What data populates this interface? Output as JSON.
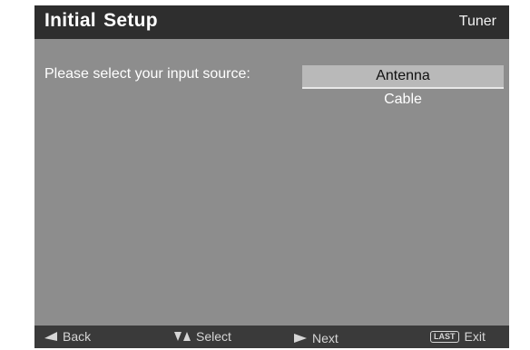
{
  "header": {
    "title": "Initial  Setup",
    "section": "Tuner"
  },
  "main": {
    "prompt": "Please select your input source:",
    "options": [
      {
        "label": "Antenna",
        "selected": true
      },
      {
        "label": "Cable",
        "selected": false
      }
    ]
  },
  "footer": {
    "back": {
      "label": "Back",
      "icon": "left-arrow-icon"
    },
    "select": {
      "label": "Select",
      "icon": "up-down-arrows-icon"
    },
    "next": {
      "label": "Next",
      "icon": "right-arrow-icon"
    },
    "exit": {
      "label": "Exit",
      "key": "LAST"
    }
  },
  "colors": {
    "background": "#8d8d8d",
    "titlebar": "#2e2e2e",
    "footer": "#3a3a3a",
    "highlight": "#b9b9b9"
  }
}
